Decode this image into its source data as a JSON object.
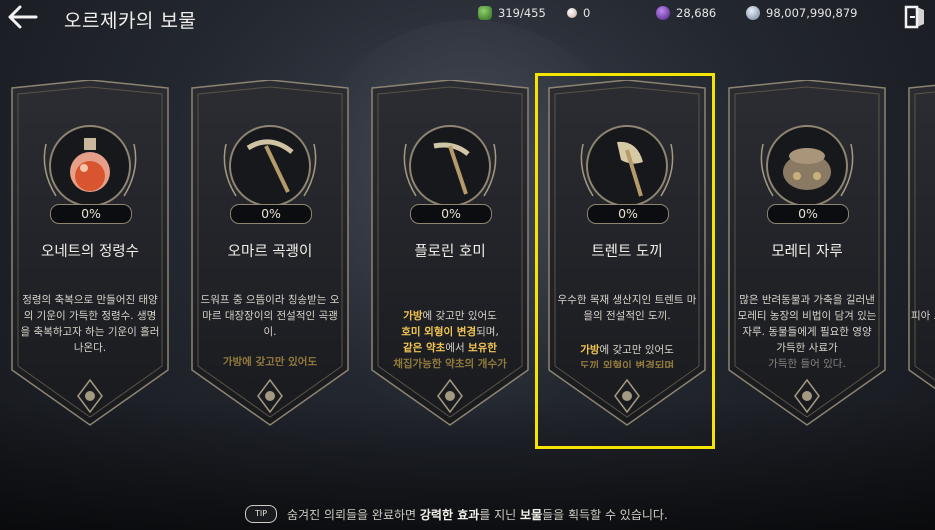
{
  "header": {
    "title": "오르제카의 보물"
  },
  "resources": [
    {
      "name": "energy",
      "icon": "green-leaf-icon",
      "value": "319/455",
      "color": "#4a8a3a"
    },
    {
      "name": "pearl",
      "icon": "pearl-icon",
      "value": "0",
      "color": "#d8c7c2"
    },
    {
      "name": "gem",
      "icon": "purple-gem-icon",
      "value": "28,686",
      "color": "#7a3fb8"
    },
    {
      "name": "silver",
      "icon": "silver-coin-icon",
      "value": "98,007,990,879",
      "color": "#a8b8cc"
    }
  ],
  "cards": [
    {
      "name": "오네트의 정령수",
      "icon": "potion-flask-icon",
      "progress": "0%",
      "desc": "정령의 축복으로 만들어진 태양의 기운이 가득한 정령수. 생명을 축복하고자 하는 기운이 흘러나온다."
    },
    {
      "name": "오마르 곡괭이",
      "icon": "pickaxe-icon",
      "progress": "0%",
      "desc": "드워프 중 으뜸이라 칭송받는 오마르 대장장이의 전설적인 곡괭이.",
      "desc_cut": "가방에 갖고만 있어도"
    },
    {
      "name": "플로린 호미",
      "icon": "hoe-icon",
      "progress": "0%",
      "desc_parts": [
        "가방",
        "에 갖고만 있어도",
        "호미 외형이 변경",
        "되며,",
        "같은 약초",
        "에서 ",
        "보유한"
      ],
      "desc_cut": "채집가능한 약초의 개수가"
    },
    {
      "name": "트렌트 도끼",
      "icon": "axe-icon",
      "progress": "0%",
      "desc": "우수한 목재 생산지인 트렌트 마을의 전설적인 도끼.",
      "desc_parts": [
        "가방",
        "에 갖고만 있어도"
      ],
      "desc_cut": "도끼 외형이 변경되며"
    },
    {
      "name": "모레티 자루",
      "icon": "sack-icon",
      "progress": "0%",
      "desc": "많은 반려동물과 가축을 길러낸 모레티 농장의 비법이 담겨 있는 자루. 동물들에게 필요한 영양 가득한 사료가",
      "desc_cut": "가득한 들어 있다."
    },
    {
      "name": "",
      "icon": "partial-card",
      "progress": "",
      "desc": "피아 드"
    }
  ],
  "tip": {
    "badge": "TIP",
    "text_a": "숨겨진 의뢰들을 완료하면 ",
    "text_b": "강력한 효과",
    "text_c": "를 지닌 ",
    "text_d": "보물",
    "text_e": "들을 획득할 수 있습니다."
  },
  "colors": {
    "selection": "#f5e400",
    "highlight": "#f1c552"
  }
}
